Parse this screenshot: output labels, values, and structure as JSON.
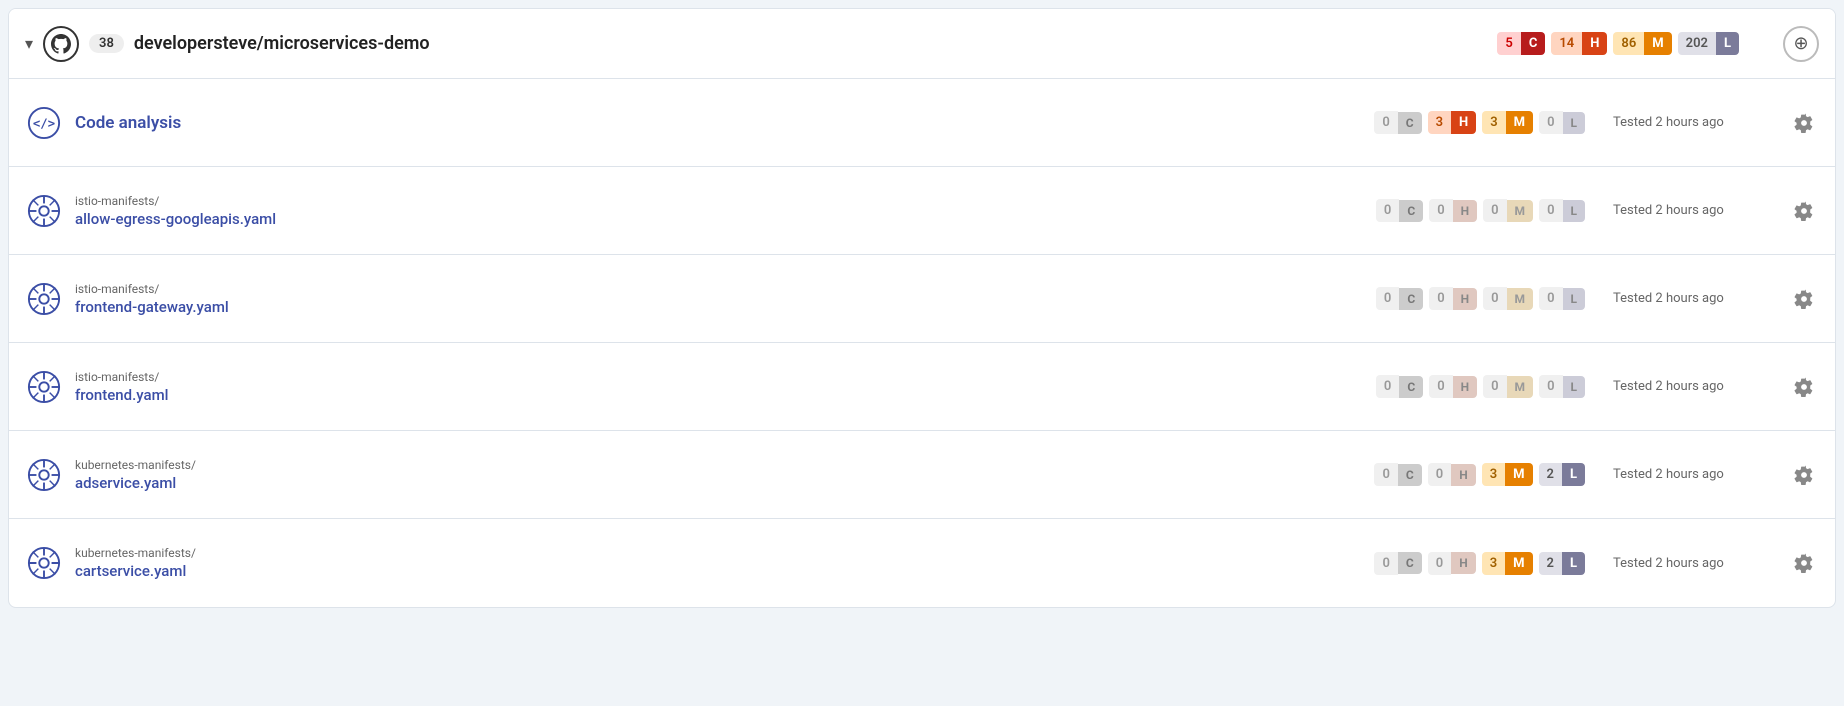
{
  "header": {
    "chevron": "▾",
    "count": "38",
    "repo": "developersteve/microservices-demo",
    "badges": [
      {
        "num": "5",
        "letter": "C",
        "numClass": "num-critical",
        "letterClass": "letter-critical"
      },
      {
        "num": "14",
        "letter": "H",
        "numClass": "num-high",
        "letterClass": "letter-high"
      },
      {
        "num": "86",
        "letter": "M",
        "numClass": "num-medium",
        "letterClass": "letter-medium"
      },
      {
        "num": "202",
        "letter": "L",
        "numClass": "num-low",
        "letterClass": "letter-low"
      }
    ],
    "add_label": "⊕"
  },
  "rows": [
    {
      "icon_type": "code",
      "folder": "",
      "name": "Code analysis",
      "badges": [
        {
          "num": "0",
          "letter": "C",
          "numClass": "num-zero",
          "letterClass": "letter-zero-c"
        },
        {
          "num": "3",
          "letter": "H",
          "numClass": "num-high",
          "letterClass": "letter-high"
        },
        {
          "num": "3",
          "letter": "M",
          "numClass": "num-medium",
          "letterClass": "letter-medium"
        },
        {
          "num": "0",
          "letter": "L",
          "numClass": "num-zero",
          "letterClass": "letter-zero-l"
        }
      ],
      "tested": "Tested 2 hours ago"
    },
    {
      "icon_type": "helm",
      "folder": "istio-manifests/",
      "name": "allow-egress-googleapis.yaml",
      "badges": [
        {
          "num": "0",
          "letter": "C",
          "numClass": "num-zero",
          "letterClass": "letter-zero-c"
        },
        {
          "num": "0",
          "letter": "H",
          "numClass": "num-zero",
          "letterClass": "letter-zero-h"
        },
        {
          "num": "0",
          "letter": "M",
          "numClass": "num-zero",
          "letterClass": "letter-zero-m"
        },
        {
          "num": "0",
          "letter": "L",
          "numClass": "num-zero",
          "letterClass": "letter-zero-l"
        }
      ],
      "tested": "Tested 2 hours ago"
    },
    {
      "icon_type": "helm",
      "folder": "istio-manifests/",
      "name": "frontend-gateway.yaml",
      "badges": [
        {
          "num": "0",
          "letter": "C",
          "numClass": "num-zero",
          "letterClass": "letter-zero-c"
        },
        {
          "num": "0",
          "letter": "H",
          "numClass": "num-zero",
          "letterClass": "letter-zero-h"
        },
        {
          "num": "0",
          "letter": "M",
          "numClass": "num-zero",
          "letterClass": "letter-zero-m"
        },
        {
          "num": "0",
          "letter": "L",
          "numClass": "num-zero",
          "letterClass": "letter-zero-l"
        }
      ],
      "tested": "Tested 2 hours ago"
    },
    {
      "icon_type": "helm",
      "folder": "istio-manifests/",
      "name": "frontend.yaml",
      "badges": [
        {
          "num": "0",
          "letter": "C",
          "numClass": "num-zero",
          "letterClass": "letter-zero-c"
        },
        {
          "num": "0",
          "letter": "H",
          "numClass": "num-zero",
          "letterClass": "letter-zero-h"
        },
        {
          "num": "0",
          "letter": "M",
          "numClass": "num-zero",
          "letterClass": "letter-zero-m"
        },
        {
          "num": "0",
          "letter": "L",
          "numClass": "num-zero",
          "letterClass": "letter-zero-l"
        }
      ],
      "tested": "Tested 2 hours ago"
    },
    {
      "icon_type": "helm",
      "folder": "kubernetes-manifests/",
      "name": "adservice.yaml",
      "badges": [
        {
          "num": "0",
          "letter": "C",
          "numClass": "num-zero",
          "letterClass": "letter-zero-c"
        },
        {
          "num": "0",
          "letter": "H",
          "numClass": "num-zero",
          "letterClass": "letter-zero-h"
        },
        {
          "num": "3",
          "letter": "M",
          "numClass": "num-medium",
          "letterClass": "letter-medium"
        },
        {
          "num": "2",
          "letter": "L",
          "numClass": "num-low",
          "letterClass": "letter-low"
        }
      ],
      "tested": "Tested 2 hours ago"
    },
    {
      "icon_type": "helm",
      "folder": "kubernetes-manifests/",
      "name": "cartservice.yaml",
      "badges": [
        {
          "num": "0",
          "letter": "C",
          "numClass": "num-zero",
          "letterClass": "letter-zero-c"
        },
        {
          "num": "0",
          "letter": "H",
          "numClass": "num-zero",
          "letterClass": "letter-zero-h"
        },
        {
          "num": "3",
          "letter": "M",
          "numClass": "num-medium",
          "letterClass": "letter-medium"
        },
        {
          "num": "2",
          "letter": "L",
          "numClass": "num-low",
          "letterClass": "letter-low"
        }
      ],
      "tested": "Tested 2 hours ago"
    }
  ]
}
